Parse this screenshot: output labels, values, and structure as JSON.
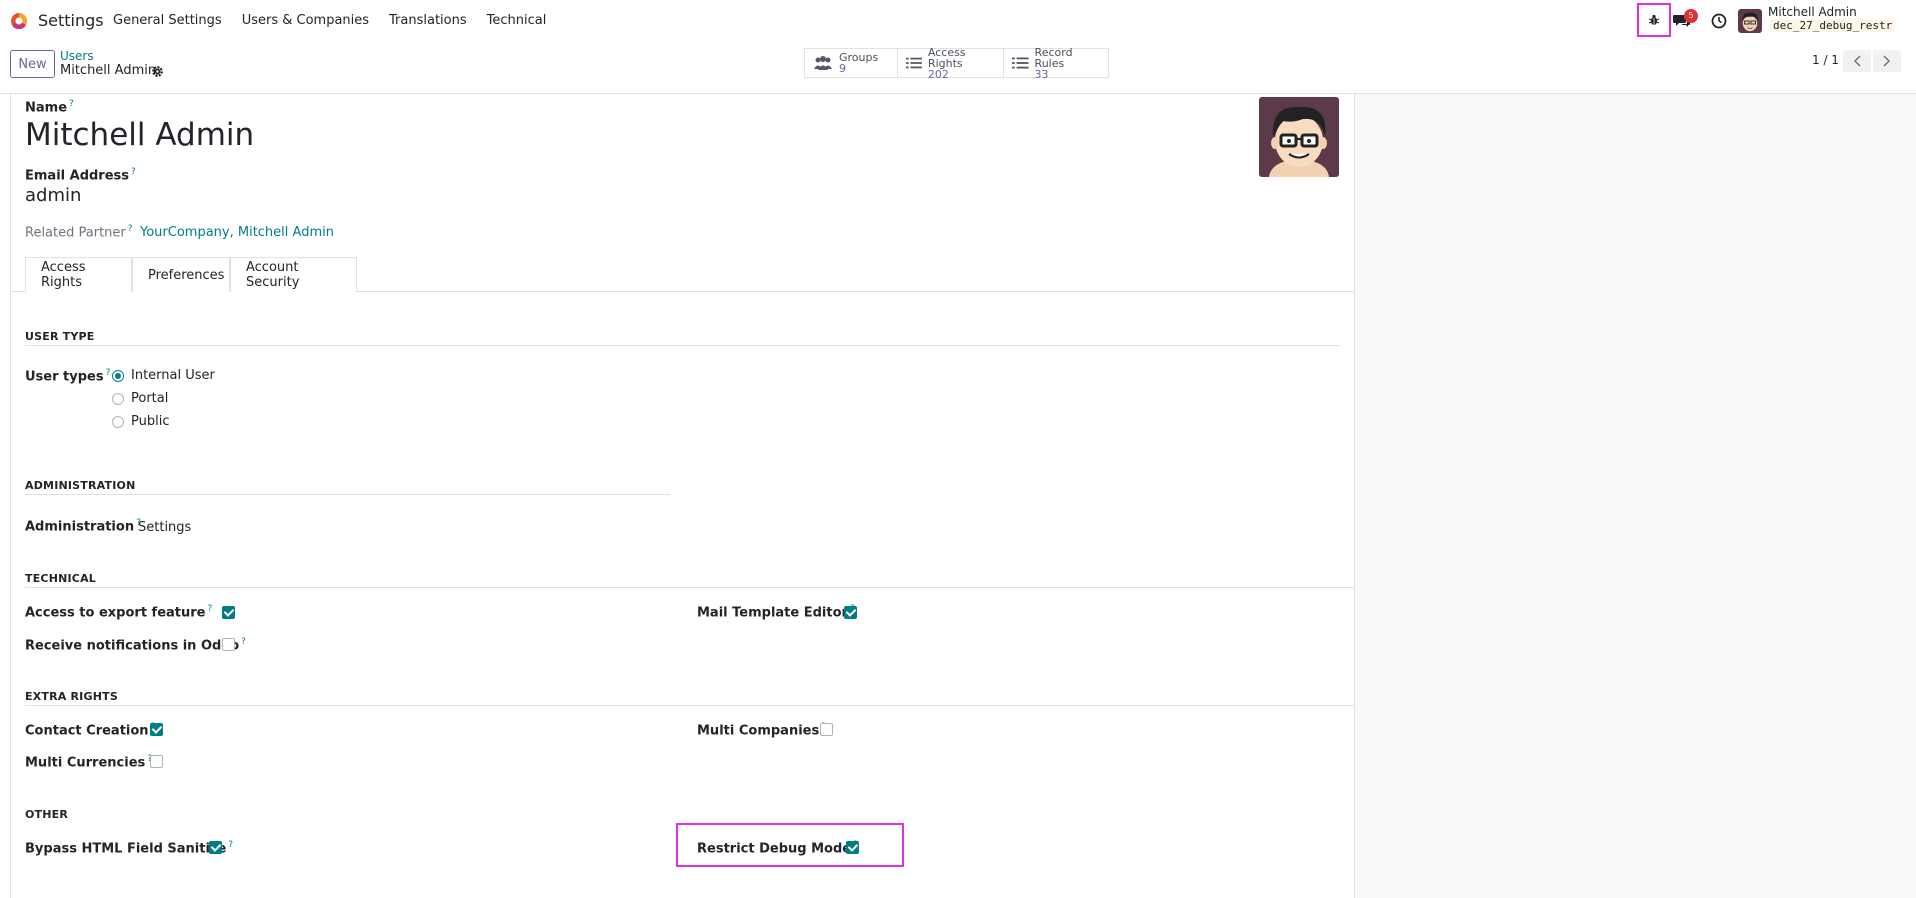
{
  "navbar": {
    "app_name": "Settings",
    "menu": [
      "General Settings",
      "Users & Companies",
      "Translations",
      "Technical"
    ],
    "notification_count": "5",
    "user_name": "Mitchell Admin",
    "db_name": "dec_27_debug_restr"
  },
  "control": {
    "new_label": "New",
    "breadcrumb_parent": "Users",
    "breadcrumb_current": "Mitchell Admin",
    "smart_buttons": [
      {
        "label": "Groups",
        "value": "9"
      },
      {
        "label": "Access Rights",
        "value": "202"
      },
      {
        "label": "Record Rules",
        "value": "33"
      }
    ],
    "pager": "1 / 1"
  },
  "form": {
    "name_label": "Name",
    "name_value": "Mitchell Admin",
    "email_label": "Email Address",
    "email_value": "admin",
    "partner_label": "Related Partner",
    "partner_value": "YourCompany, Mitchell Admin",
    "help_mark": "?"
  },
  "tabs": [
    "Access Rights",
    "Preferences",
    "Account Security"
  ],
  "sections": {
    "user_type": "USER TYPE",
    "administration": "ADMINISTRATION",
    "technical": "TECHNICAL",
    "extra_rights": "EXTRA RIGHTS",
    "other": "OTHER"
  },
  "user_type": {
    "label": "User types",
    "options": [
      "Internal User",
      "Portal",
      "Public"
    ],
    "selected": "Internal User"
  },
  "administration": {
    "label": "Administration",
    "value": "Settings"
  },
  "technical": {
    "export_label": "Access to export feature",
    "export_checked": true,
    "notifications_label": "Receive notifications in Odoo",
    "notifications_checked": false,
    "mail_template_label": "Mail Template Editor",
    "mail_template_checked": true
  },
  "extra_rights": {
    "contact_label": "Contact Creation",
    "contact_checked": true,
    "currencies_label": "Multi Currencies",
    "currencies_checked": false,
    "companies_label": "Multi Companies",
    "companies_checked": false
  },
  "other": {
    "bypass_label": "Bypass HTML Field Sanitize",
    "bypass_checked": true,
    "restrict_label": "Restrict Debug Mode",
    "restrict_checked": true
  },
  "colors": {
    "accent": "#017e84",
    "brand": "#71639e",
    "highlight": "#e22fe2",
    "badge": "#e03030"
  }
}
